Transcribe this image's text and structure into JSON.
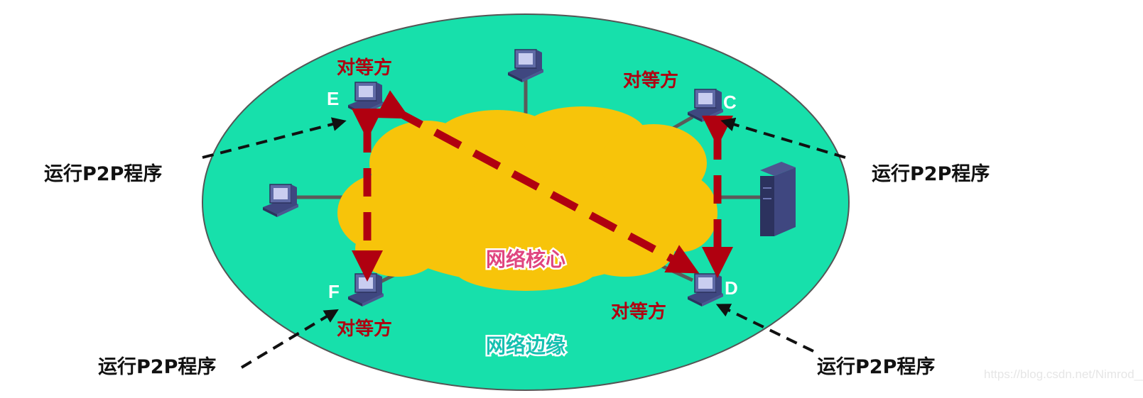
{
  "labels": {
    "run_program": "运行P2P程序",
    "peer": "对等方",
    "network_core": "网络核心",
    "network_edge": "网络边缘"
  },
  "nodes": {
    "E": "E",
    "F": "F",
    "C": "C",
    "D": "D"
  },
  "watermark": "https://blog.csdn.net/Nimrod__",
  "colors": {
    "edge_fill": "#17e0ab",
    "core_fill": "#f7c40a",
    "arrow_red": "#b00010",
    "computer": "#5f6aa6"
  }
}
